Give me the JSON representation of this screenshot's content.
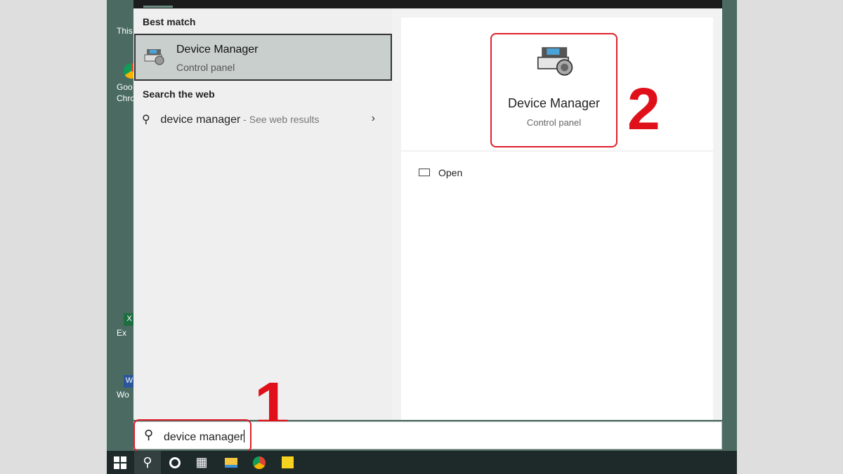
{
  "desktop": {
    "icons": [
      "This",
      "Goo Chro",
      "Ex",
      "Wo"
    ]
  },
  "results": {
    "best_match_header": "Best match",
    "best_match": {
      "title": "Device Manager",
      "subtitle": "Control panel"
    },
    "search_web_header": "Search the web",
    "web_item": {
      "query": "device manager",
      "hint": " - See web results"
    }
  },
  "preview": {
    "title": "Device Manager",
    "subtitle": "Control panel",
    "open_label": "Open"
  },
  "annotations": {
    "step1": "1",
    "step2": "2",
    "color": "#e0101a"
  },
  "search": {
    "value": "device manager"
  },
  "taskbar": {
    "items": [
      "start-icon",
      "search-icon",
      "cortana-icon",
      "task-view-icon",
      "file-explorer-icon",
      "chrome-icon",
      "sticky-notes-icon"
    ]
  }
}
